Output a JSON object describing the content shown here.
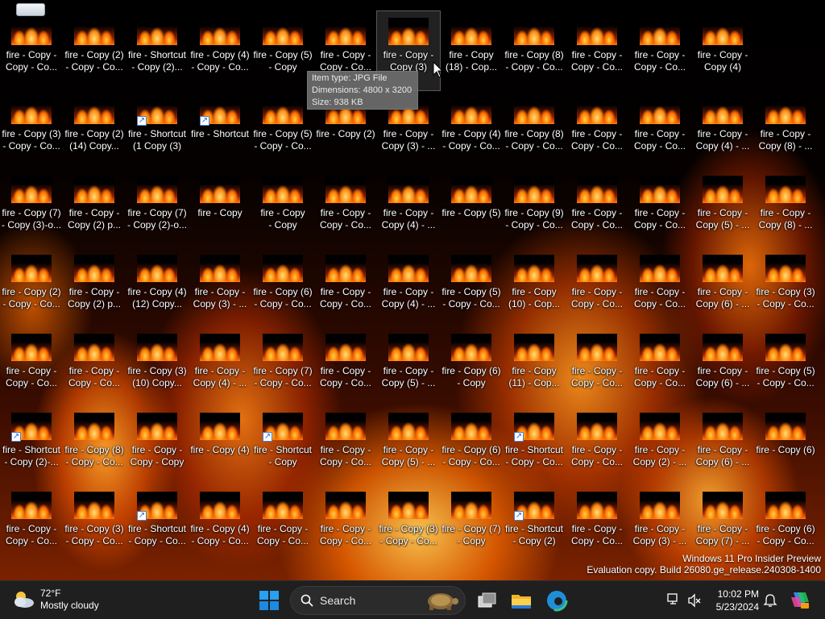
{
  "desktop": {
    "tooltip": {
      "line1": "Item type: JPG File",
      "line2": "Dimensions: 4800 x 3200",
      "line3": "Size: 938 KB"
    },
    "watermark": {
      "line1": "Windows 11 Pro Insider Preview",
      "line2": "Evaluation copy. Build 26080.ge_release.240308-1400"
    },
    "rows": [
      [
        {
          "label": "fire - Copy -\nCopy - Co...",
          "shortcut": false
        },
        {
          "label": "fire - Copy (2)\n- Copy - Co...",
          "shortcut": false
        },
        {
          "label": "fire - Shortcut\n- Copy (2)...",
          "shortcut": false
        },
        {
          "label": "fire - Copy (4)\n- Copy - Co...",
          "shortcut": false
        },
        {
          "label": "fire - Copy (5)\n- Copy",
          "shortcut": false
        },
        {
          "label": "fire - Copy -\nCopy - Co...",
          "shortcut": false
        },
        {
          "label": "fire - Copy -\nCopy (3)",
          "shortcut": false,
          "selected": true
        },
        {
          "label": "fire - Copy\n(18) - Cop...",
          "shortcut": false
        },
        {
          "label": "fire - Copy (8)\n- Copy - Co...",
          "shortcut": false
        },
        {
          "label": "fire - Copy -\nCopy - Co...",
          "shortcut": false
        },
        {
          "label": "fire - Copy -\nCopy - Co...",
          "shortcut": false
        },
        {
          "label": "fire - Copy -\nCopy (4)",
          "shortcut": false
        }
      ],
      [
        {
          "label": "fire - Copy (3)\n- Copy - Co...",
          "shortcut": false
        },
        {
          "label": "fire - Copy (2)\n(14) Copy...",
          "shortcut": false
        },
        {
          "label": "fire - Shortcut\n(1 Copy (3)",
          "shortcut": true
        },
        {
          "label": "fire - Shortcut",
          "shortcut": true
        },
        {
          "label": "fire - Copy (5)\n- Copy - Co...",
          "shortcut": false
        },
        {
          "label": "fire - Copy (2)",
          "shortcut": false
        },
        {
          "label": "fire - Copy -\nCopy (3) - ...",
          "shortcut": false
        },
        {
          "label": "fire - Copy (4)\n- Copy - Co...",
          "shortcut": false
        },
        {
          "label": "fire - Copy (8)\n- Copy - Co...",
          "shortcut": false
        },
        {
          "label": "fire - Copy -\nCopy - Co...",
          "shortcut": false
        },
        {
          "label": "fire - Copy -\nCopy - Co...",
          "shortcut": false
        },
        {
          "label": "fire - Copy -\nCopy (4) - ...",
          "shortcut": false
        },
        {
          "label": "fire - Copy -\nCopy (8) - ...",
          "shortcut": false
        }
      ],
      [
        {
          "label": "fire - Copy (7)\n- Copy (3)-o...",
          "shortcut": false
        },
        {
          "label": "fire - Copy -\nCopy (2) p...",
          "shortcut": false
        },
        {
          "label": "fire - Copy (7)\n- Copy (2)-o...",
          "shortcut": false
        },
        {
          "label": "fire - Copy",
          "shortcut": false
        },
        {
          "label": "fire - Copy\n- Copy",
          "shortcut": false
        },
        {
          "label": "fire - Copy -\nCopy - Co...",
          "shortcut": false
        },
        {
          "label": "fire - Copy -\nCopy (4) - ...",
          "shortcut": false
        },
        {
          "label": "fire - Copy (5)",
          "shortcut": false
        },
        {
          "label": "fire - Copy (9)\n- Copy - Co...",
          "shortcut": false
        },
        {
          "label": "fire - Copy -\nCopy - Co...",
          "shortcut": false
        },
        {
          "label": "fire - Copy -\nCopy - Co...",
          "shortcut": false
        },
        {
          "label": "fire - Copy -\nCopy (5) - ...",
          "shortcut": false
        },
        {
          "label": "fire - Copy -\nCopy (8) - ...",
          "shortcut": false
        }
      ],
      [
        {
          "label": "fire - Copy (2)\n- Copy - Co...",
          "shortcut": false
        },
        {
          "label": "fire - Copy -\nCopy (2) p...",
          "shortcut": false
        },
        {
          "label": "fire - Copy (4)\n(12) Copy...",
          "shortcut": false
        },
        {
          "label": "fire - Copy -\nCopy (3) - ...",
          "shortcut": false
        },
        {
          "label": "fire - Copy (6)\n- Copy - Co...",
          "shortcut": false
        },
        {
          "label": "fire - Copy -\nCopy - Co...",
          "shortcut": false
        },
        {
          "label": "fire - Copy -\nCopy (4) - ...",
          "shortcut": false
        },
        {
          "label": "fire - Copy (5)\n- Copy - Co...",
          "shortcut": false
        },
        {
          "label": "fire - Copy\n(10) - Cop...",
          "shortcut": false
        },
        {
          "label": "fire - Copy -\nCopy - Co...",
          "shortcut": false
        },
        {
          "label": "fire - Copy -\nCopy - Co...",
          "shortcut": false
        },
        {
          "label": "fire - Copy -\nCopy (6) - ...",
          "shortcut": false
        },
        {
          "label": "fire - Copy (3)\n- Copy - Co...",
          "shortcut": false
        }
      ],
      [
        {
          "label": "fire - Copy -\nCopy - Co...",
          "shortcut": false
        },
        {
          "label": "fire - Copy -\nCopy - Co...",
          "shortcut": false
        },
        {
          "label": "fire - Copy (3)\n(10) Copy...",
          "shortcut": false
        },
        {
          "label": "fire - Copy -\nCopy (4) - ...",
          "shortcut": false
        },
        {
          "label": "fire - Copy (7)\n- Copy - Co...",
          "shortcut": false
        },
        {
          "label": "fire - Copy -\nCopy - Co...",
          "shortcut": false
        },
        {
          "label": "fire - Copy -\nCopy (5) - ...",
          "shortcut": false
        },
        {
          "label": "fire - Copy (6)\n- Copy",
          "shortcut": false
        },
        {
          "label": "fire - Copy\n(11) - Cop...",
          "shortcut": false
        },
        {
          "label": "fire - Copy -\nCopy - Co...",
          "shortcut": false
        },
        {
          "label": "fire - Copy -\nCopy - Co...",
          "shortcut": false
        },
        {
          "label": "fire - Copy -\nCopy (6) - ...",
          "shortcut": false
        },
        {
          "label": "fire - Copy (5)\n- Copy - Co...",
          "shortcut": false
        }
      ],
      [
        {
          "label": "fire - Shortcut\n- Copy (2)-...",
          "shortcut": true
        },
        {
          "label": "fire - Copy (8)\n- Copy - Co...",
          "shortcut": false
        },
        {
          "label": "fire - Copy -\nCopy - Copy",
          "shortcut": false
        },
        {
          "label": "fire - Copy (4)",
          "shortcut": false
        },
        {
          "label": "fire - Shortcut\n- Copy",
          "shortcut": true
        },
        {
          "label": "fire - Copy -\nCopy - Co...",
          "shortcut": false
        },
        {
          "label": "fire - Copy -\nCopy (5) - ...",
          "shortcut": false
        },
        {
          "label": "fire - Copy (6)\n- Copy - Co...",
          "shortcut": false
        },
        {
          "label": "fire - Shortcut\n- Copy - Co...",
          "shortcut": true
        },
        {
          "label": "fire - Copy -\nCopy - Co...",
          "shortcut": false
        },
        {
          "label": "fire - Copy -\nCopy (2) - ...",
          "shortcut": false
        },
        {
          "label": "fire - Copy -\nCopy (6) - ...",
          "shortcut": false
        },
        {
          "label": "fire - Copy (6)",
          "shortcut": false
        }
      ],
      [
        {
          "label": "fire - Copy -\nCopy - Co...",
          "shortcut": false
        },
        {
          "label": "fire - Copy (3)\n- Copy - Co...",
          "shortcut": false
        },
        {
          "label": "fire - Shortcut\n- Copy - Co...",
          "shortcut": true
        },
        {
          "label": "fire - Copy (4)\n- Copy - Co...",
          "shortcut": false
        },
        {
          "label": "fire - Copy -\nCopy - Co...",
          "shortcut": false
        },
        {
          "label": "fire - Copy -\nCopy - Co...",
          "shortcut": false
        },
        {
          "label": "fire - Copy (3)\n- Copy - Co...",
          "shortcut": false
        },
        {
          "label": "fire - Copy (7)\n- Copy",
          "shortcut": false
        },
        {
          "label": "fire - Shortcut\n- Copy (2)",
          "shortcut": true
        },
        {
          "label": "fire - Copy -\nCopy - Co...",
          "shortcut": false
        },
        {
          "label": "fire - Copy -\nCopy (3) - ...",
          "shortcut": false
        },
        {
          "label": "fire - Copy -\nCopy (7) - ...",
          "shortcut": false
        },
        {
          "label": "fire - Copy (6)\n- Copy - Co...",
          "shortcut": false
        }
      ]
    ]
  },
  "taskbar": {
    "weather": {
      "temp": "72°F",
      "condition": "Mostly cloudy"
    },
    "search": {
      "placeholder": "Search"
    },
    "clock": {
      "time": "10:02 PM",
      "date": "5/23/2024"
    },
    "icons": [
      "windows-start-icon",
      "task-view-icon",
      "file-explorer-icon",
      "edge-browser-icon",
      "network-icon",
      "volume-muted-icon",
      "notification-bell-icon",
      "copilot-icon"
    ],
    "accent": "#0078d4"
  }
}
